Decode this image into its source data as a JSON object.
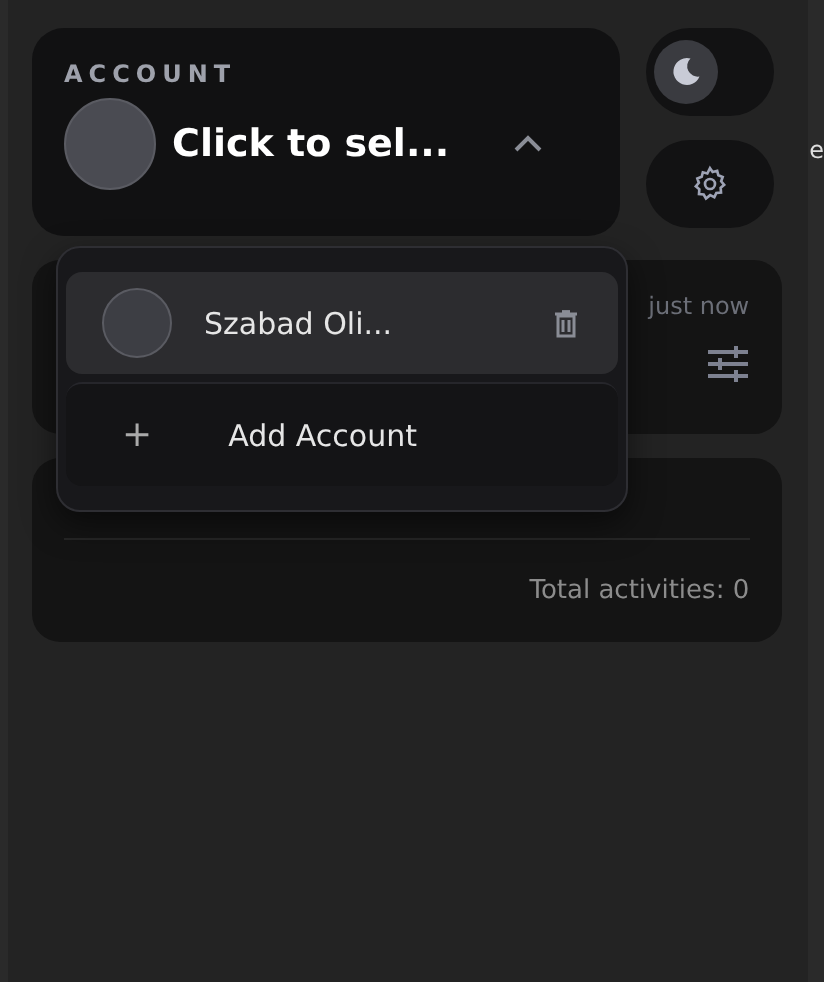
{
  "account": {
    "label": "ACCOUNT",
    "selected_name": "Click to sel...",
    "expanded": true
  },
  "dropdown": {
    "accounts": [
      {
        "name": "Szabad Oli..."
      }
    ],
    "add_icon": "+",
    "add_label": "Add Account"
  },
  "status_card": {
    "time": "just now"
  },
  "activity_card": {
    "total": "Total activities: 0"
  },
  "theme_toggle": {
    "on": true
  },
  "edge_text": "e"
}
